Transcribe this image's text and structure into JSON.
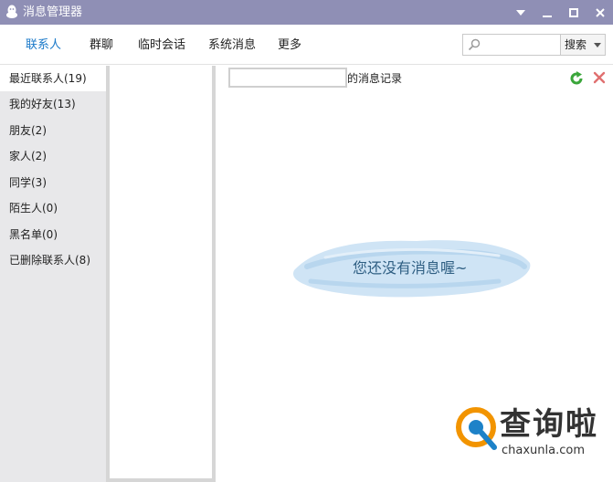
{
  "window": {
    "title": "消息管理器"
  },
  "nav": {
    "tabs": [
      {
        "label": "联系人",
        "active": true
      },
      {
        "label": "群聊"
      },
      {
        "label": "临时会话"
      },
      {
        "label": "系统消息"
      },
      {
        "label": "更多"
      }
    ]
  },
  "search": {
    "placeholder": "",
    "button_label": "搜索"
  },
  "sidebar": {
    "items": [
      {
        "label": "最近联系人(19)",
        "active": true
      },
      {
        "label": "我的好友(13)"
      },
      {
        "label": "朋友(2)"
      },
      {
        "label": "家人(2)"
      },
      {
        "label": "同学(3)"
      },
      {
        "label": "陌生人(0)"
      },
      {
        "label": "黑名单(0)"
      },
      {
        "label": "已删除联系人(8)"
      }
    ]
  },
  "content": {
    "history_suffix": "的消息记录",
    "empty_message": "您还没有消息喔~"
  },
  "watermark": {
    "brand": "查询啦",
    "domain": "chaxunla.com"
  },
  "colors": {
    "titlebar": "#8f8fb5",
    "active_tab": "#1a79c9",
    "sidebar_bg": "#e8e8ea",
    "refresh_icon": "#3aa63a",
    "delete_icon": "#e07070",
    "empty_text": "#2f5f83",
    "brand_orange": "#f29400",
    "brand_blue": "#1d82c8"
  }
}
